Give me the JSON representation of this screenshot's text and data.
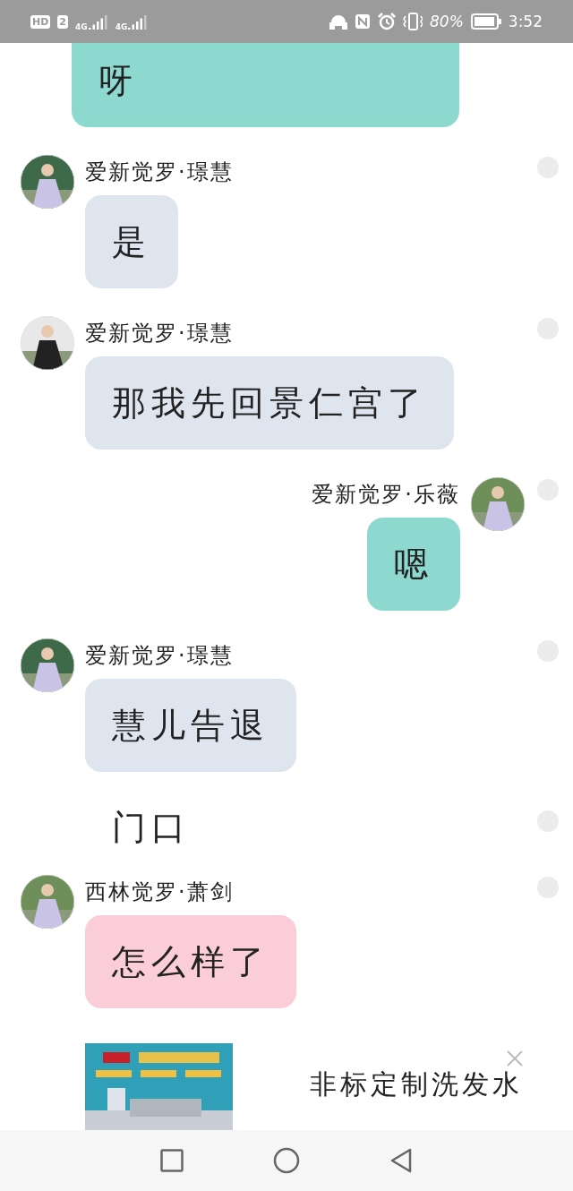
{
  "status_bar": {
    "badges": [
      "HD",
      "2"
    ],
    "networks": [
      "4G",
      "4G"
    ],
    "battery_text": "80%",
    "time": "3:52"
  },
  "messages": [
    {
      "kind": "tail",
      "mine": true,
      "color": "#8dd9d0",
      "text": "呀"
    },
    {
      "kind": "bubble",
      "mine": false,
      "color": "#dfe5ee",
      "name": "爱新觉罗·璟慧",
      "text": "是"
    },
    {
      "kind": "bubble",
      "mine": false,
      "color": "#dfe5ee",
      "name": "爱新觉罗·璟慧",
      "text": "那我先回景仁宫了"
    },
    {
      "kind": "bubble",
      "mine": true,
      "color": "#8dd9d0",
      "name": "爱新觉罗·乐薇",
      "text": "嗯"
    },
    {
      "kind": "bubble",
      "mine": false,
      "color": "#dfe5ee",
      "name": "爱新觉罗·璟慧",
      "text": "慧儿告退"
    },
    {
      "kind": "plain",
      "mine": false,
      "text": "门口"
    },
    {
      "kind": "bubble",
      "mine": false,
      "color": "#fbcdd9",
      "name": "西林觉罗·萧剑",
      "text": "怎么样了"
    }
  ],
  "ad": {
    "title": "非标定制洗发水"
  }
}
